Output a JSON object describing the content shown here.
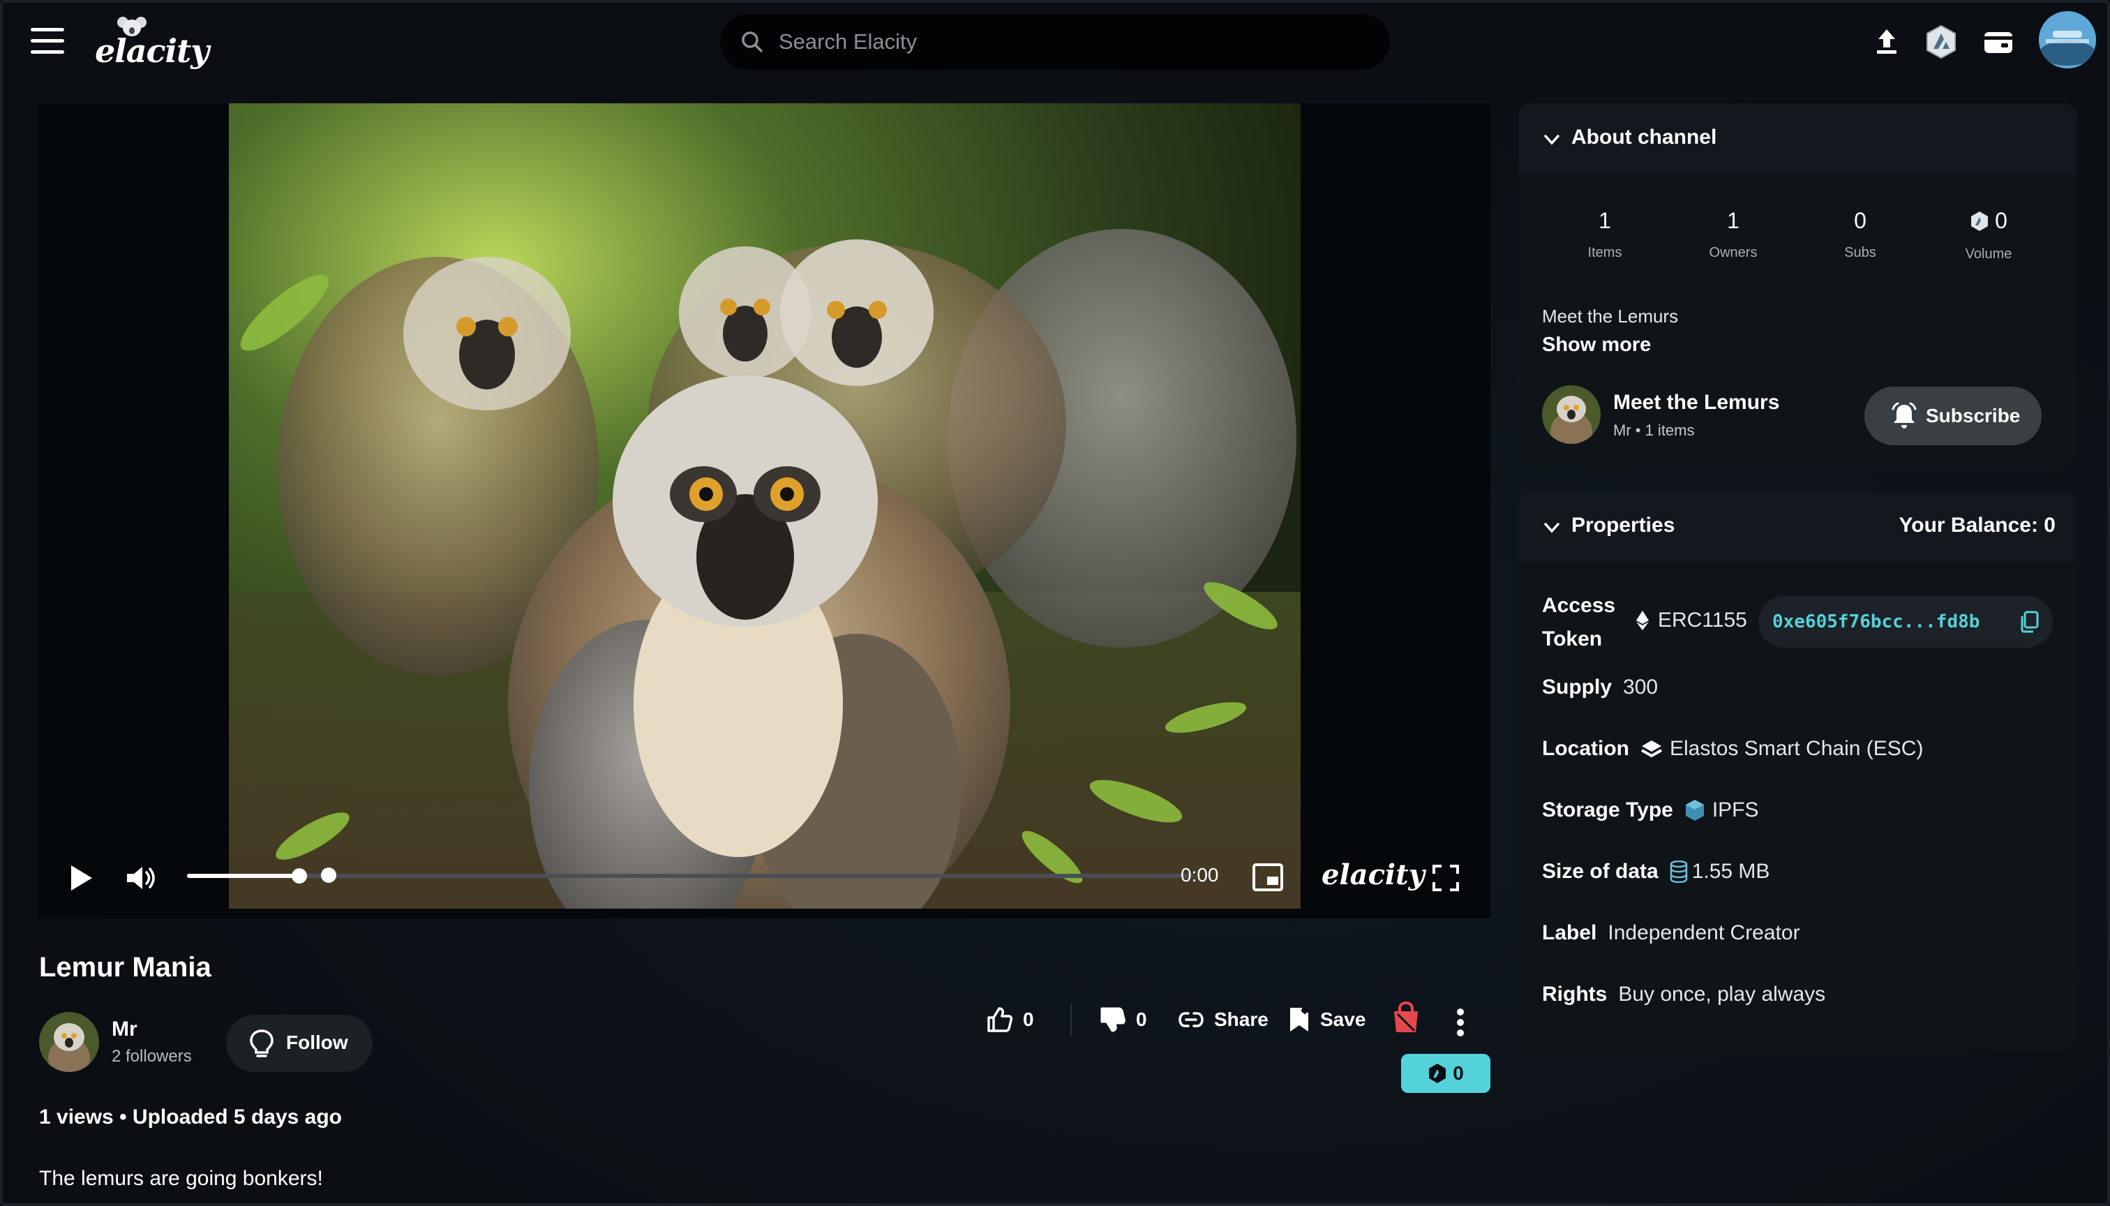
{
  "header": {
    "logo_text": "elacity",
    "search_placeholder": "Search Elacity"
  },
  "player": {
    "time": "0:00",
    "logo_text": "elacity",
    "progress_fraction": 0.0,
    "volume_fraction": 0.2
  },
  "video": {
    "title": "Lemur Mania",
    "creator_name": "Mr",
    "creator_followers": "2 followers",
    "follow_label": "Follow",
    "likes": "0",
    "dislikes": "0",
    "share_label": "Share",
    "save_label": "Save",
    "tip_amount": "0",
    "meta": "1 views • Uploaded 5 days ago",
    "description": "The lemurs are going bonkers!"
  },
  "about": {
    "title": "About channel",
    "stats": [
      {
        "value": "1",
        "label": "Items"
      },
      {
        "value": "1",
        "label": "Owners"
      },
      {
        "value": "0",
        "label": "Subs"
      },
      {
        "value": "0",
        "label": "Volume"
      }
    ],
    "description": "Meet the Lemurs",
    "show_more": "Show more",
    "channel_name": "Meet the Lemurs",
    "channel_sub": "Mr • 1 items",
    "subscribe_label": "Subscribe"
  },
  "properties": {
    "title": "Properties",
    "balance": "Your Balance: 0",
    "access_token_label_1": "Access",
    "access_token_label_2": "Token",
    "token_standard": "ERC1155",
    "token_address": "0xe605f76bcc...fd8b",
    "supply_label": "Supply",
    "supply_value": "300",
    "location_label": "Location",
    "location_value": "Elastos Smart Chain (ESC)",
    "storage_label": "Storage Type",
    "storage_value": "IPFS",
    "size_label": "Size of data",
    "size_value": "1.55 MB",
    "label_label": "Label",
    "label_value": "Independent Creator",
    "rights_label": "Rights",
    "rights_value": "Buy once, play always"
  },
  "colors": {
    "background": "#0b0f14",
    "accent_cyan": "#53d3d9",
    "address_text": "#55d1d8",
    "danger_red": "#e5484d"
  }
}
